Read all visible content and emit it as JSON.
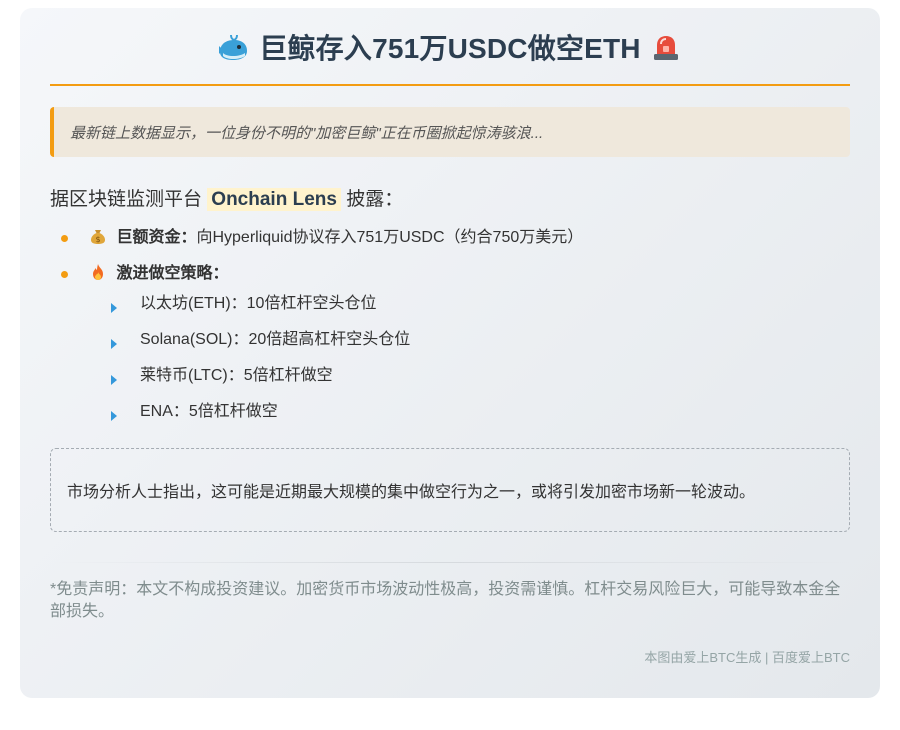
{
  "header": {
    "title": "巨鲸存入751万USDC做空ETH",
    "left_icon": "whale-icon",
    "right_icon": "siren-icon"
  },
  "intro": "最新链上数据显示，一位身份不明的\"加密巨鲸\"正在币圈掀起惊涛骇浪...",
  "lead": {
    "prefix": "据区块链监测平台",
    "highlight": "Onchain Lens",
    "suffix": "披露："
  },
  "items": [
    {
      "icon": "money-bag-icon",
      "label": "巨额资金：",
      "text": "向Hyperliquid协议存入751万USDC（约合750万美元）"
    },
    {
      "icon": "fire-icon",
      "label": "激进做空策略：",
      "text": ""
    }
  ],
  "positions": [
    "以太坊(ETH)：10倍杠杆空头仓位",
    "Solana(SOL)：20倍超高杠杆空头仓位",
    "莱特币(LTC)：5倍杠杆做空",
    "ENA：5倍杠杆做空"
  ],
  "analysis": "市场分析人士指出，这可能是近期最大规模的集中做空行为之一，或将引发加密市场新一轮波动。",
  "disclaimer": "*免责声明：本文不构成投资建议。加密货币市场波动性极高，投资需谨慎。杠杆交易风险巨大，可能导致本金全部损失。",
  "footer": "本图由爱上BTC生成 | 百度爱上BTC",
  "colors": {
    "accent": "#f39c12",
    "title": "#2c3e50",
    "sub_bullet": "#3498db",
    "highlight_bg": "#fff3cd",
    "muted": "#7f8c8d"
  }
}
